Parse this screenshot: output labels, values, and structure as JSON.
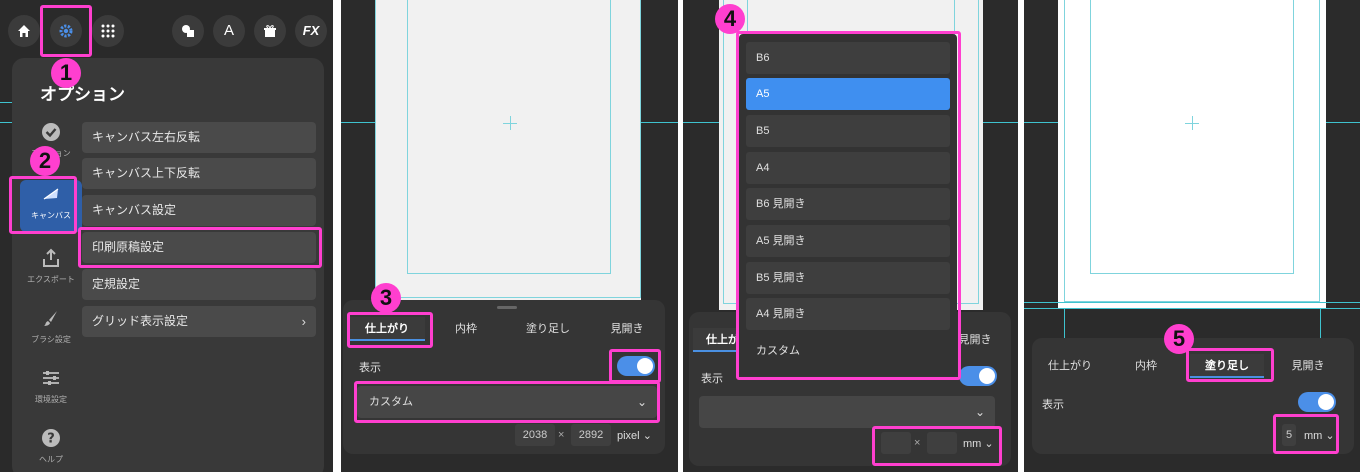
{
  "steps": [
    "1",
    "2",
    "3",
    "4",
    "5"
  ],
  "panel1": {
    "fx_label": "FX",
    "a_label": "A",
    "popup_title": "オプション",
    "sidebar": [
      {
        "label": "アクション",
        "icon": "checkmark-circle-icon"
      },
      {
        "label": "キャンバス",
        "icon": "canvas-icon"
      },
      {
        "label": "エクスポート",
        "icon": "export-icon"
      },
      {
        "label": "ブラシ設定",
        "icon": "brush-icon"
      },
      {
        "label": "環境設定",
        "icon": "sliders-icon"
      },
      {
        "label": "ヘルプ",
        "icon": "help-icon"
      }
    ],
    "menu": [
      {
        "label": "キャンバス左右反転"
      },
      {
        "label": "キャンバス上下反転"
      },
      {
        "label": "キャンバス設定"
      },
      {
        "label": "印刷原稿設定"
      },
      {
        "label": "定規設定"
      },
      {
        "label": "グリッド表示設定"
      }
    ]
  },
  "tabs": {
    "finish": "仕上がり",
    "inner": "内枠",
    "bleed": "塗り足し",
    "spread": "見開き"
  },
  "display_label": "表示",
  "panel2": {
    "preset_value": "カスタム",
    "width": "2038",
    "height": "2892",
    "times": "×",
    "unit": "pixel"
  },
  "panel3": {
    "options": [
      "B6",
      "A5",
      "B5",
      "A4",
      "B6 見開き",
      "A5 見開き",
      "B5 見開き",
      "A4 見開き",
      "カスタム"
    ],
    "selected_index": 1,
    "times": "×",
    "unit": "mm"
  },
  "panel4": {
    "bleed_value": "5",
    "unit": "mm"
  },
  "colors": {
    "highlight": "#ff3fcf",
    "accent": "#3f8ff0",
    "guide": "#3fc3cf"
  }
}
